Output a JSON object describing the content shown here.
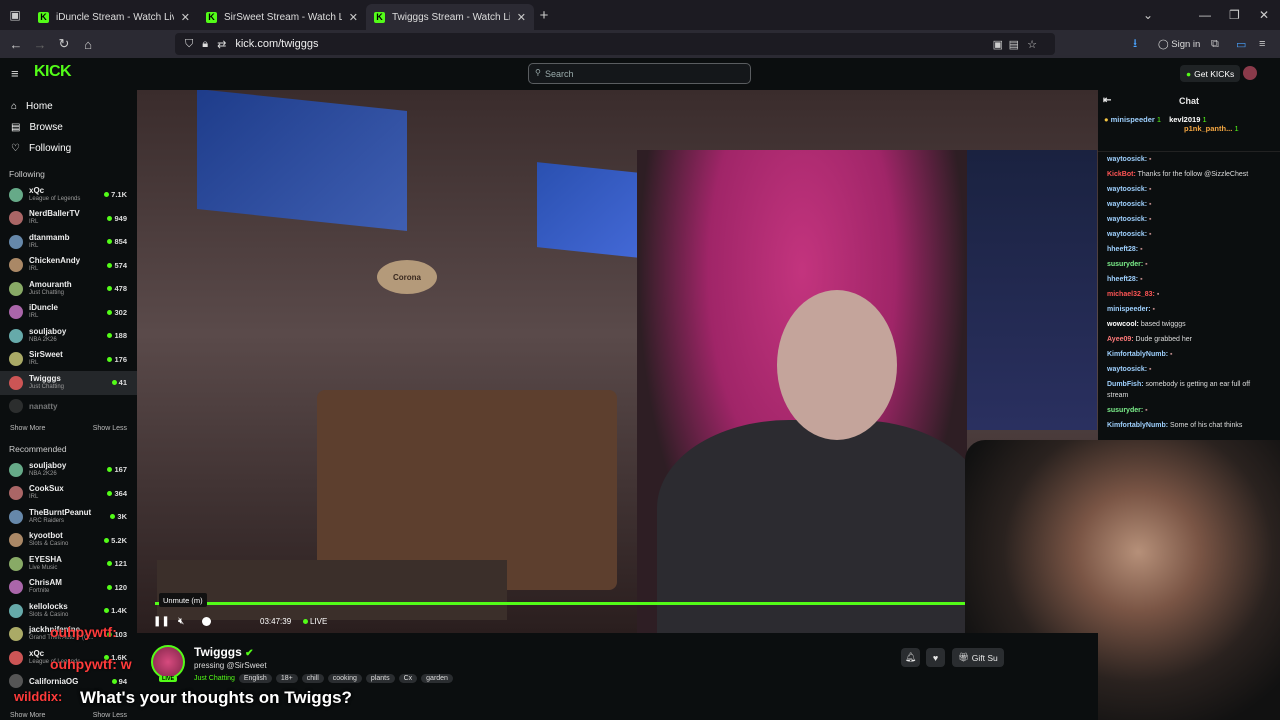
{
  "browser": {
    "tabs": [
      {
        "label": "iDuncle Stream - Watch Live on"
      },
      {
        "label": "SirSweet Stream - Watch Live on"
      },
      {
        "label": "Twigggs Stream - Watch Live on"
      }
    ],
    "url": "kick.com/twigggs",
    "sign_in": "Sign in"
  },
  "kick": {
    "logo": "KICK",
    "search_placeholder": "Search",
    "get_kicks": "Get KICKs"
  },
  "sidebar": {
    "nav": [
      {
        "label": "Home"
      },
      {
        "label": "Browse"
      },
      {
        "label": "Following"
      }
    ],
    "following_header": "Following",
    "following": [
      {
        "name": "xQc",
        "cat": "League of Legends",
        "viewers": "7.1K"
      },
      {
        "name": "NerdBallerTV",
        "cat": "IRL",
        "viewers": "949"
      },
      {
        "name": "dtanmamb",
        "cat": "IRL",
        "viewers": "854"
      },
      {
        "name": "ChickenAndy",
        "cat": "IRL",
        "viewers": "574"
      },
      {
        "name": "Amouranth",
        "cat": "Just Chatting",
        "viewers": "478"
      },
      {
        "name": "iDuncle",
        "cat": "IRL",
        "viewers": "302"
      },
      {
        "name": "souljaboy",
        "cat": "NBA 2K26",
        "viewers": "188"
      },
      {
        "name": "SirSweet",
        "cat": "IRL",
        "viewers": "176"
      },
      {
        "name": "Twigggs",
        "cat": "Just Chatting",
        "viewers": "41"
      },
      {
        "name": "nanatty",
        "cat": "",
        "viewers": ""
      }
    ],
    "show_more": "Show More",
    "show_less": "Show Less",
    "recommended_header": "Recommended",
    "recommended": [
      {
        "name": "souljaboy",
        "cat": "NBA 2K26",
        "viewers": "167"
      },
      {
        "name": "CookSux",
        "cat": "IRL",
        "viewers": "364"
      },
      {
        "name": "TheBurntPeanut",
        "cat": "ARC Raiders",
        "viewers": "3K"
      },
      {
        "name": "kyootbot",
        "cat": "Slots & Casino",
        "viewers": "5.2K"
      },
      {
        "name": "EYESHA",
        "cat": "Live Music",
        "viewers": "121"
      },
      {
        "name": "ChrisAM",
        "cat": "Fortnite",
        "viewers": "120"
      },
      {
        "name": "kellolocks",
        "cat": "Slots & Casino",
        "viewers": "1.4K"
      },
      {
        "name": "jackhnifenine",
        "cat": "Grand Theft Auto V (G...",
        "viewers": "103"
      },
      {
        "name": "xQc",
        "cat": "League of Legends",
        "viewers": "1.6K"
      },
      {
        "name": "CaliforniaOG",
        "cat": "",
        "viewers": "94"
      }
    ]
  },
  "player": {
    "tooltip": "Unmute (m)",
    "time": "03:47:39",
    "live": "LIVE",
    "sign_text": "Corona"
  },
  "stream": {
    "name": "Twigggs",
    "title": "pressing @SirSweet",
    "category": "Just Chatting",
    "tags": [
      "English",
      "18+",
      "chill",
      "cooking",
      "plants",
      "Cx",
      "garden"
    ],
    "gift": "Gift Su",
    "live_badge": "LIVE"
  },
  "chat": {
    "title": "Chat",
    "pinned": [
      {
        "user": "minispeeder",
        "amount": "1"
      },
      {
        "user": "kevl2019",
        "amount": "1"
      },
      {
        "user": "p1nk_panth...",
        "amount": "1"
      }
    ],
    "messages": [
      {
        "user": "waytoosick:",
        "text": "",
        "color": "#9fd1ff"
      },
      {
        "user": "KickBot:",
        "text": "Thanks for the follow @SizzleChest",
        "color": "#ff5555"
      },
      {
        "user": "waytoosick:",
        "text": "",
        "color": "#9fd1ff"
      },
      {
        "user": "waytoosick:",
        "text": "",
        "color": "#9fd1ff"
      },
      {
        "user": "waytoosick:",
        "text": "",
        "color": "#9fd1ff"
      },
      {
        "user": "waytoosick:",
        "text": "",
        "color": "#9fd1ff"
      },
      {
        "user": "hheeft28:",
        "text": "",
        "color": "#9fd1ff"
      },
      {
        "user": "susuryder:",
        "text": "",
        "color": "#7cf08b"
      },
      {
        "user": "hheeft28:",
        "text": "",
        "color": "#9fd1ff"
      },
      {
        "user": "michael32_83:",
        "text": "",
        "color": "#ff5555"
      },
      {
        "user": "minispeeder:",
        "text": "",
        "color": "#9fd1ff"
      },
      {
        "user": "wowcool:",
        "text": "based twigggs",
        "color": "#ffffff"
      },
      {
        "user": "Ayee09:",
        "text": "Dude grabbed her",
        "color": "#ff7a7a"
      },
      {
        "user": "KimfortablyNumb:",
        "text": "",
        "color": "#9fd1ff"
      },
      {
        "user": "waytoosick:",
        "text": "",
        "color": "#9fd1ff"
      },
      {
        "user": "DumbFish:",
        "text": "somebody is getting an ear full off stream",
        "color": "#9fd1ff"
      },
      {
        "user": "susuryder:",
        "text": "",
        "color": "#7cf08b"
      },
      {
        "user": "KimfortablyNumb:",
        "text": "Some of his chat thinks",
        "color": "#9fd1ff"
      }
    ]
  },
  "overlay": {
    "caption": "What's your thoughts on Twiggs?",
    "ov1": "ouhpywtf:",
    "ov2": "ouhpywtf: w",
    "ov3": "wilddix:"
  },
  "colors": {
    "accent": "#53fc18",
    "bg": "#0b0e0f"
  }
}
